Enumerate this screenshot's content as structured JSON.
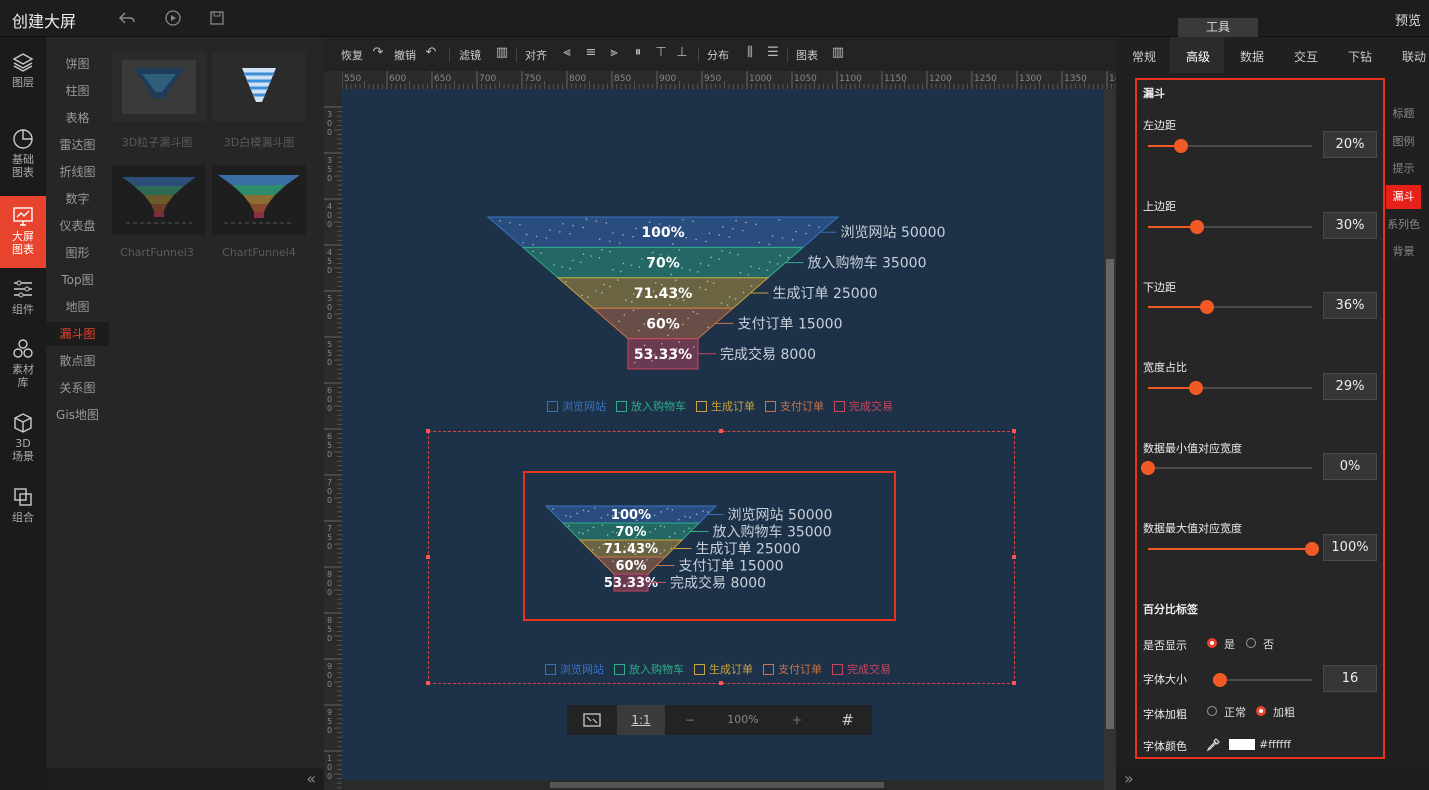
{
  "header": {
    "title": "创建大屏",
    "tool_tab": "工具",
    "preview": "预览"
  },
  "left_nav": [
    {
      "label": "图层",
      "icon": "layers-icon"
    },
    {
      "label": "基础图表",
      "icon": "pie-chart-icon"
    },
    {
      "label": "大屏图表",
      "icon": "chart-icon",
      "active": true
    },
    {
      "label": "组件",
      "icon": "sliders-icon"
    },
    {
      "label": "素材库",
      "icon": "assets-icon"
    },
    {
      "label": "3D场景",
      "icon": "cube-icon"
    },
    {
      "label": "组合",
      "icon": "group-icon"
    }
  ],
  "sub_nav": [
    "饼图",
    "柱图",
    "表格",
    "雷达图",
    "折线图",
    "数字",
    "仪表盘",
    "图形",
    "Top图",
    "地图",
    "漏斗图",
    "散点图",
    "关系图",
    "Gis地图"
  ],
  "sub_nav_active": "漏斗图",
  "gallery": [
    "3D粒子漏斗图",
    "3D白模漏斗图",
    "ChartFunnel3",
    "ChartFunnel4"
  ],
  "toolbar": {
    "restore": "恢复",
    "undo": "撤销",
    "filter": "滤镜",
    "align": "对齐",
    "distribute": "分布",
    "chart": "图表"
  },
  "ruler_top": [
    "550",
    "600",
    "650",
    "700",
    "750",
    "800",
    "850",
    "900",
    "950",
    "1000",
    "1050",
    "1100",
    "1150",
    "1200",
    "1250",
    "1300",
    "1350",
    "14"
  ],
  "ruler_left": [
    "3 0 0",
    "3 5 0",
    "4 0 0",
    "4 5 0",
    "5 0 0",
    "5 5 0",
    "6 0 0",
    "6 5 0",
    "7 0 0",
    "7 5 0",
    "8 0 0",
    "8 5 0",
    "9 0 0",
    "9 5 0",
    "1 0 0"
  ],
  "funnel": {
    "stages": [
      {
        "name": "浏览网站",
        "value": "50000",
        "pct": "100%",
        "color": "#3a72c2"
      },
      {
        "name": "放入购物车",
        "value": "35000",
        "pct": "70%",
        "color": "#2fae87"
      },
      {
        "name": "生成订单",
        "value": "25000",
        "pct": "71.43%",
        "color": "#c9a43c"
      },
      {
        "name": "支付订单",
        "value": "15000",
        "pct": "60%",
        "color": "#c77447"
      },
      {
        "name": "完成交易",
        "value": "8000",
        "pct": "53.33%",
        "color": "#c8485c"
      }
    ]
  },
  "zoom": {
    "fit": "⛶",
    "one_to_one": "1:1",
    "minus": "−",
    "level": "100%",
    "plus": "+",
    "grid": "#"
  },
  "right_tabs": [
    "常规",
    "高级",
    "数据",
    "交互",
    "下钻",
    "联动"
  ],
  "right_tab_active": "高级",
  "vtabs": [
    "标题",
    "图例",
    "提示",
    "漏斗",
    "系列色",
    "背景"
  ],
  "vtab_active": "漏斗",
  "panel": {
    "section": "漏斗",
    "left_margin": {
      "label": "左边距",
      "value": "20%",
      "level": 0.2
    },
    "top_margin": {
      "label": "上边距",
      "value": "30%",
      "level": 0.3
    },
    "bottom_margin": {
      "label": "下边距",
      "value": "36%",
      "level": 0.36
    },
    "width_ratio": {
      "label": "宽度占比",
      "value": "29%",
      "level": 0.29
    },
    "min_width": {
      "label": "数据最小值对应宽度",
      "value": "0%",
      "level": 0
    },
    "max_width": {
      "label": "数据最大值对应宽度",
      "value": "100%",
      "level": 1
    },
    "pct_section": "百分比标签",
    "show": {
      "label": "是否显示",
      "yes": "是",
      "no": "否",
      "selected": "是"
    },
    "font_size": {
      "label": "字体大小",
      "value": "16",
      "level": 0.06
    },
    "bold": {
      "label": "字体加粗",
      "normal": "正常",
      "bold": "加粗",
      "selected": "加粗"
    },
    "font_color": {
      "label": "字体颜色",
      "value": "#ffffff"
    }
  }
}
